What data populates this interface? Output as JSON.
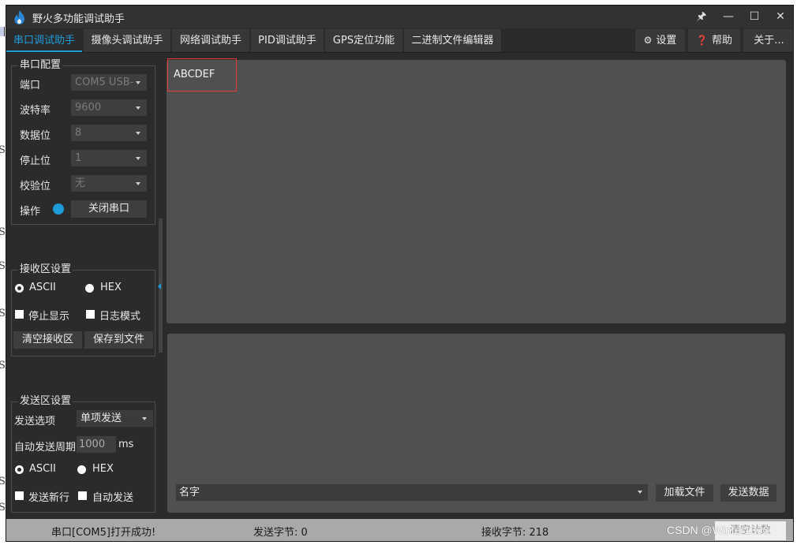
{
  "window": {
    "title": "野火多功能调试助手"
  },
  "titlebar": {
    "pin": "🖈",
    "minimize": "—",
    "maximize": "☐",
    "close": "✕"
  },
  "tabs": [
    {
      "label": "串口调试助手"
    },
    {
      "label": "摄像头调试助手"
    },
    {
      "label": "网络调试助手"
    },
    {
      "label": "PID调试助手"
    },
    {
      "label": "GPS定位功能"
    },
    {
      "label": "二进制文件编辑器"
    }
  ],
  "right_menu": {
    "settings": "设置",
    "help": "帮助",
    "about": "关于..."
  },
  "serial_config": {
    "title": "串口配置",
    "port_label": "端口",
    "port_value": "COM5 USB-",
    "baud_label": "波特率",
    "baud_value": "9600",
    "databits_label": "数据位",
    "databits_value": "8",
    "stopbits_label": "停止位",
    "stopbits_value": "1",
    "parity_label": "校验位",
    "parity_value": "无",
    "op_label": "操作",
    "close_button": "关闭串口"
  },
  "recv_settings": {
    "title": "接收区设置",
    "ascii": "ASCII",
    "hex": "HEX",
    "stop_display": "停止显示",
    "log_mode": "日志模式",
    "clear_button": "清空接收区",
    "save_button": "保存到文件"
  },
  "send_settings": {
    "title": "发送区设置",
    "option_label": "发送选项",
    "option_value": "单项发送",
    "period_label": "自动发送周期",
    "period_value": "1000",
    "period_unit": "ms",
    "ascii": "ASCII",
    "hex": "HEX",
    "newline": "发送新行",
    "auto_send": "自动发送"
  },
  "receive_area": {
    "text": "ABCDEF"
  },
  "send_area": {
    "name_value": "名字",
    "load_file_button": "加载文件",
    "send_button": "发送数据"
  },
  "status": {
    "message": "串口[COM5]打开成功!",
    "sent_bytes": "发送字节: 0",
    "recv_bytes": "接收字节: 218",
    "clear_count_button": "清空计数"
  },
  "watermark": "CSDN @Winter1300",
  "colors": {
    "accent": "#1e9bd8",
    "background": "#2b2b2b",
    "panel": "#505050",
    "highlight": "#e53a3a"
  }
}
